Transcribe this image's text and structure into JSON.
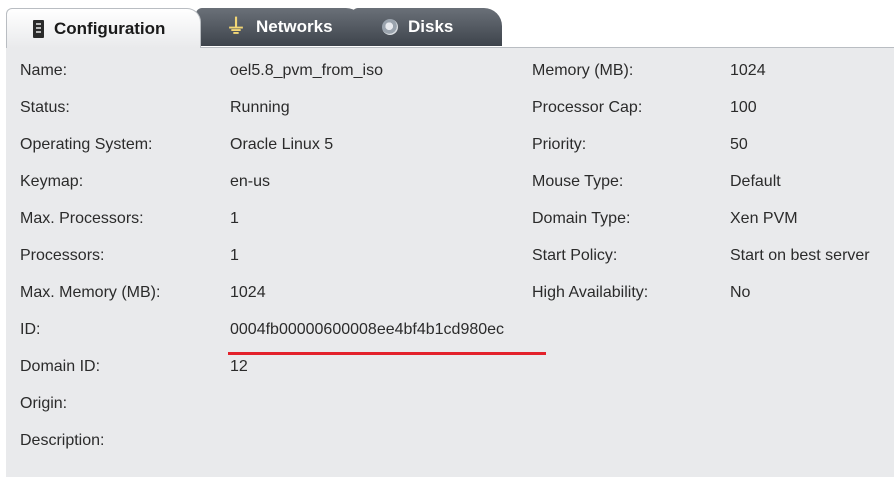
{
  "tabs": {
    "configuration": "Configuration",
    "networks": "Networks",
    "disks": "Disks"
  },
  "left": [
    {
      "label": "Name:",
      "value": "oel5.8_pvm_from_iso"
    },
    {
      "label": "Status:",
      "value": "Running"
    },
    {
      "label": "Operating System:",
      "value": "Oracle Linux 5"
    },
    {
      "label": "Keymap:",
      "value": "en-us"
    },
    {
      "label": "Max. Processors:",
      "value": "1"
    },
    {
      "label": "Processors:",
      "value": "1"
    },
    {
      "label": "Max. Memory (MB):",
      "value": "1024"
    },
    {
      "label": "ID:",
      "value": "0004fb00000600008ee4bf4b1cd980ec"
    },
    {
      "label": "Domain ID:",
      "value": "12"
    },
    {
      "label": "Origin:",
      "value": ""
    },
    {
      "label": "Description:",
      "value": ""
    }
  ],
  "right": [
    {
      "label": "Memory (MB):",
      "value": "1024"
    },
    {
      "label": "Processor Cap:",
      "value": "100"
    },
    {
      "label": "Priority:",
      "value": "50"
    },
    {
      "label": "Mouse Type:",
      "value": "Default"
    },
    {
      "label": "Domain Type:",
      "value": "Xen PVM"
    },
    {
      "label": "Start Policy:",
      "value": "Start on best server"
    },
    {
      "label": "High Availability:",
      "value": "No"
    }
  ],
  "colors": {
    "panel_bg": "#e9eaec",
    "active_tab_bg": "#ffffff",
    "inactive_tab_bg": "#4f555d",
    "highlight_underline": "#e3212b"
  }
}
